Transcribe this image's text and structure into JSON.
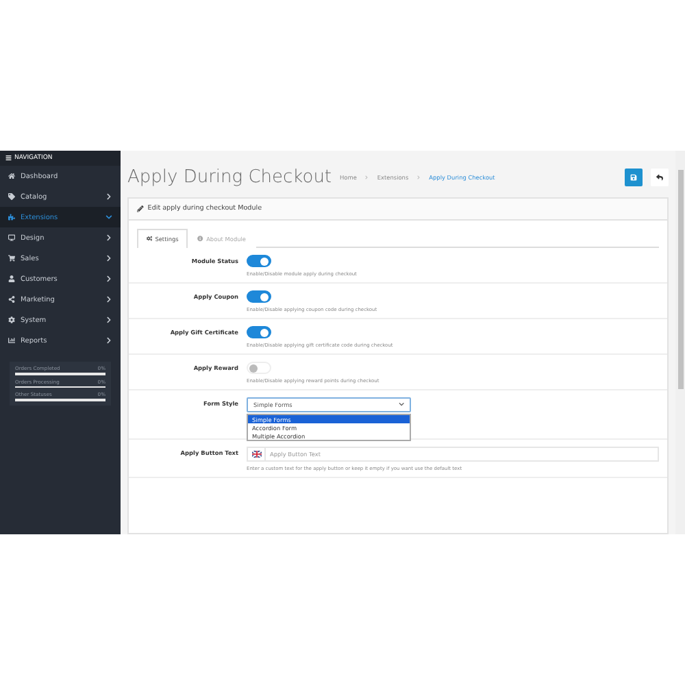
{
  "navigation": {
    "title": "NAVIGATION",
    "items": [
      {
        "label": "Dashboard",
        "has_arrow": false,
        "selected": false
      },
      {
        "label": "Catalog",
        "has_arrow": true,
        "selected": false
      },
      {
        "label": "Extensions",
        "has_arrow": true,
        "selected": true
      },
      {
        "label": "Design",
        "has_arrow": true,
        "selected": false
      },
      {
        "label": "Sales",
        "has_arrow": true,
        "selected": false
      },
      {
        "label": "Customers",
        "has_arrow": true,
        "selected": false
      },
      {
        "label": "Marketing",
        "has_arrow": true,
        "selected": false
      },
      {
        "label": "System",
        "has_arrow": true,
        "selected": false
      },
      {
        "label": "Reports",
        "has_arrow": true,
        "selected": false
      }
    ],
    "stats": [
      {
        "label": "Orders Completed",
        "value": "0%",
        "level": 0
      },
      {
        "label": "Orders Processing",
        "value": "0%",
        "level": 0
      },
      {
        "label": "Other Statuses",
        "value": "0%",
        "level": 0
      }
    ]
  },
  "page": {
    "title": "Apply During Checkout",
    "breadcrumbs": [
      "Home",
      "Extensions",
      "Apply During Checkout"
    ]
  },
  "panel": {
    "title": "Edit apply during checkout Module",
    "tabs": [
      {
        "label": "Settings",
        "selected": true
      },
      {
        "label": "About Module",
        "selected": false
      }
    ],
    "fields": [
      {
        "kind": "toggle",
        "label": "Module Status",
        "on": true,
        "help": "Enable/Disable module apply during checkout"
      },
      {
        "kind": "toggle",
        "label": "Apply Coupon",
        "on": true,
        "help": "Enable/Disable applying coupon code during checkout"
      },
      {
        "kind": "toggle",
        "label": "Apply Gift Certificate",
        "on": true,
        "help": "Enable/Disable applying gift certificate code during checkout"
      },
      {
        "kind": "toggle",
        "label": "Apply Reward",
        "on": false,
        "help": "Enable/Disable applying reward points during checkout"
      },
      {
        "kind": "select",
        "label": "Form Style",
        "value": "Simple Forms",
        "options": [
          {
            "label": "Simple Forms",
            "selected": true
          },
          {
            "label": "Accordion Form",
            "selected": false
          },
          {
            "label": "Multiple Accordion",
            "selected": false
          }
        ]
      },
      {
        "kind": "text",
        "label": "Apply Button Text",
        "placeholder": "Apply Button Text",
        "help": "Enter a custom text for the apply button or keep it empty if you want use the default text"
      }
    ]
  }
}
